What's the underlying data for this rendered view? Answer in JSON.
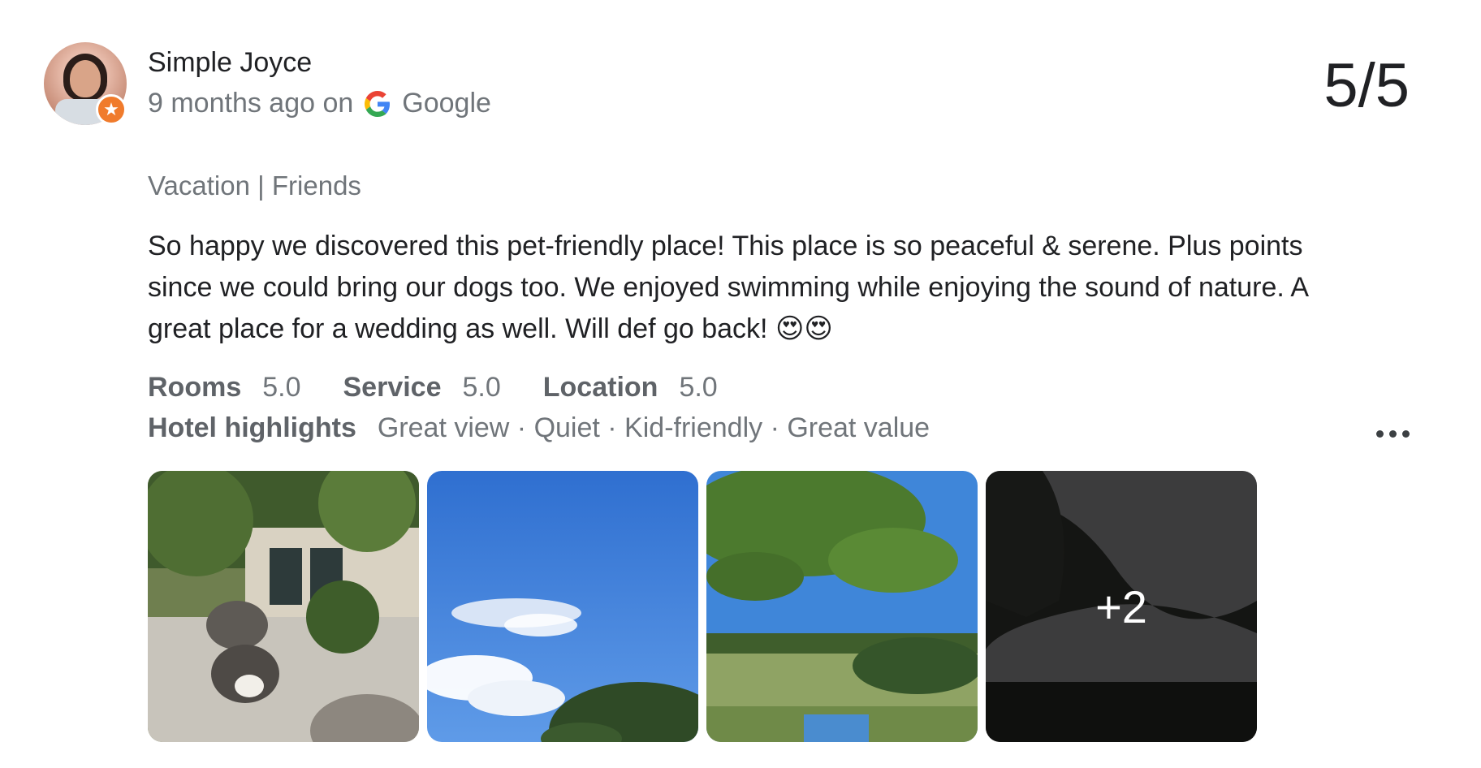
{
  "review": {
    "author": "Simple Joyce",
    "time_ago": "9 months ago on",
    "source": "Google",
    "score": "5/5",
    "trip_type": "Vacation | Friends",
    "text": "So happy we discovered this pet-friendly place! This place is so peaceful & serene. Plus points since we could bring our dogs too. We enjoyed swimming while enjoying the sound of nature. A great place for a wedding as well. Will def go back! 😍😍",
    "ratings": [
      {
        "label": "Rooms",
        "value": "5.0"
      },
      {
        "label": "Service",
        "value": "5.0"
      },
      {
        "label": "Location",
        "value": "5.0"
      }
    ],
    "highlights_label": "Hotel highlights",
    "highlights": "Great view · Quiet · Kid-friendly · Great value",
    "more_photos": "+2",
    "photos": [
      {
        "icon": "garden-patio-photo"
      },
      {
        "icon": "blue-sky-photo"
      },
      {
        "icon": "tree-landscape-photo"
      },
      {
        "icon": "dusk-tree-photo"
      }
    ]
  },
  "colors": {
    "badge": "#f07b2c",
    "text": "#202124",
    "muted": "#70757a"
  }
}
